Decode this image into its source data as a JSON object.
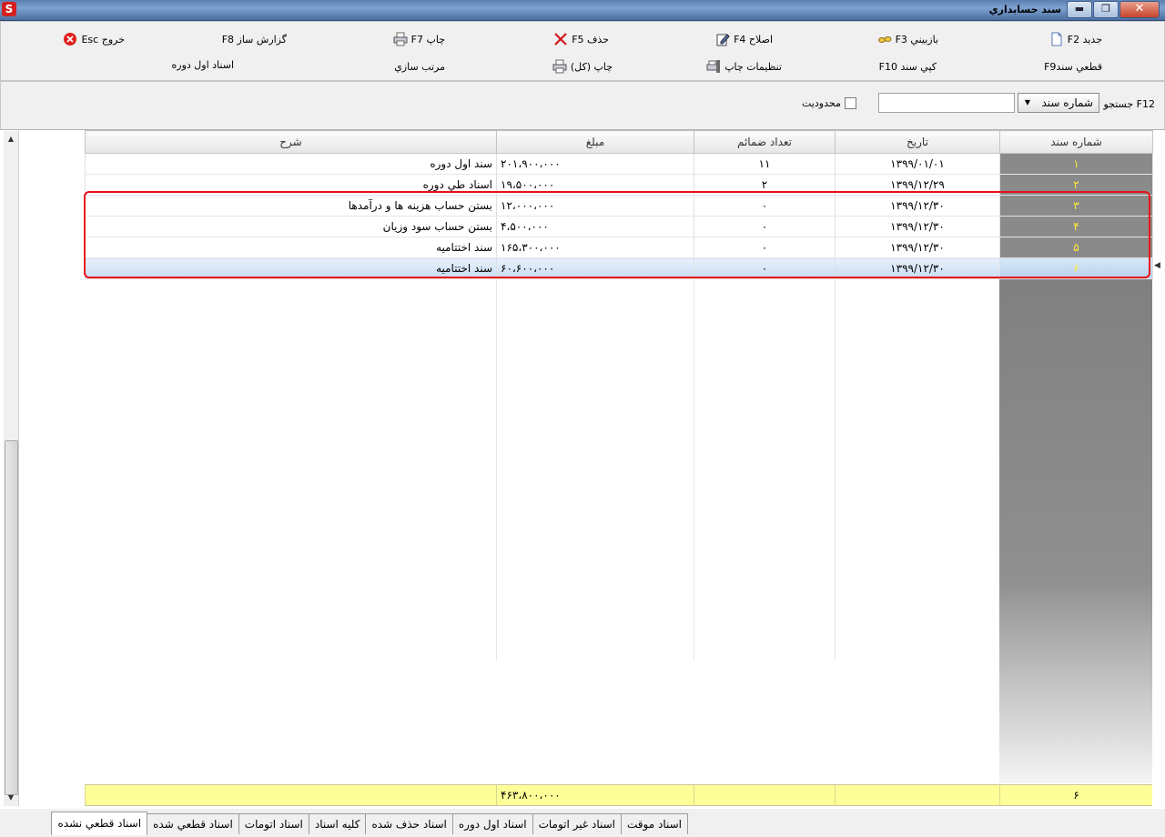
{
  "window": {
    "title": "سند حسابداري",
    "close": "✕",
    "restore": "❐",
    "minimize": "▬"
  },
  "toolbar": {
    "new": "جديد   F2",
    "view": "بازبيني F3",
    "edit": "اصلاح F4",
    "delete": "حذف F5",
    "print": "چاپ  F7",
    "report": "گزارش ساز F8",
    "exit": "خروج Esc",
    "finalize": "قطعي سندF9",
    "copy": "كپي سند F10",
    "print_settings": "تنظيمات چاپ",
    "print_all": "چاپ (كل)",
    "sort": "مرتب سازي",
    "opening_docs": "اسناد اول دوره"
  },
  "search": {
    "label": "جستجو F12",
    "field": "شماره سند",
    "value": "",
    "limit_label": "محدوديت"
  },
  "columns": [
    "شماره سند",
    "تاريخ",
    "تعداد ضمائم",
    "مبلغ",
    "شرح"
  ],
  "rows": [
    {
      "num": "۱",
      "date": "۱۳۹۹/۰۱/۰۱",
      "count": "۱۱",
      "amount": "۲۰۱،۹۰۰،۰۰۰",
      "desc": "سند اول دوره"
    },
    {
      "num": "۲",
      "date": "۱۳۹۹/۱۲/۲۹",
      "count": "۲",
      "amount": "۱۹،۵۰۰،۰۰۰",
      "desc": "اسناد طي دوره"
    },
    {
      "num": "۳",
      "date": "۱۳۹۹/۱۲/۳۰",
      "count": "۰",
      "amount": "۱۲،۰۰۰،۰۰۰",
      "desc": "بستن حساب هزينه ها و درآمدها"
    },
    {
      "num": "۴",
      "date": "۱۳۹۹/۱۲/۳۰",
      "count": "۰",
      "amount": "۴،۵۰۰،۰۰۰",
      "desc": "بستن حساب سود وزيان"
    },
    {
      "num": "۵",
      "date": "۱۳۹۹/۱۲/۳۰",
      "count": "۰",
      "amount": "۱۶۵،۳۰۰،۰۰۰",
      "desc": "سند اختتاميه"
    },
    {
      "num": "۶",
      "date": "۱۳۹۹/۱۲/۳۰",
      "count": "۰",
      "amount": "۶۰،۶۰۰،۰۰۰",
      "desc": "سند اختتاميه"
    }
  ],
  "selected_row": 6,
  "footer": {
    "count": "۶",
    "total": "۴۶۳،۸۰۰،۰۰۰"
  },
  "tabs": [
    "اسناد موقت",
    "اسناد غير اتومات",
    "اسناد اول دوره",
    "اسناد حذف شده",
    "كليه اسناد",
    "اسناد اتومات",
    "اسناد قطعي شده",
    "اسناد قطعي نشده"
  ],
  "active_tab": 7,
  "colors": {
    "accent_highlight": "#e8101a",
    "footer_bg": "#ffff99",
    "number_col_bg": "#8a8a8a",
    "number_text": "#ffeb3b"
  }
}
